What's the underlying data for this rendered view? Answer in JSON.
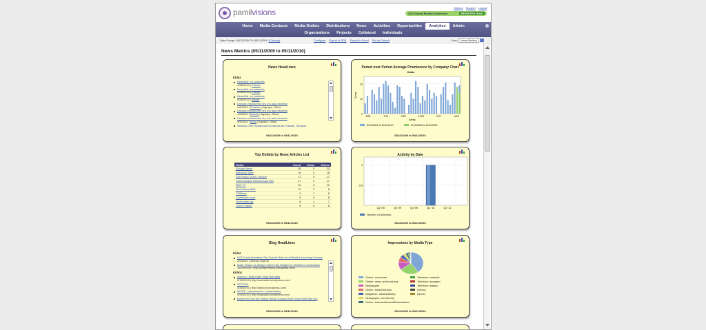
{
  "brand": {
    "prefix": "pamil",
    "suffix": "visions"
  },
  "top_links": [
    "Options",
    "Support",
    "Logout"
  ],
  "conference_banner": {
    "text": "2010 Social Media Conference",
    "button": "REGISTER NOW"
  },
  "nav": {
    "row1": [
      "Home",
      "Media Contacts",
      "Media Outlets",
      "Distributions",
      "News",
      "Activities",
      "Opportunities",
      "Analytics",
      "Admin"
    ],
    "active": "Analytics",
    "row2": [
      "Organizations",
      "Projects",
      "Collateral",
      "Individuals"
    ]
  },
  "subbar": {
    "date_range_label": "Date Range:",
    "date_from": "05/11/2009",
    "date_to_label": "To",
    "date_to": "05/11/2010",
    "change_link": "(Change)",
    "links": [
      "Configure",
      "Export to PDF",
      "Export to Excel",
      "Set as Default"
    ],
    "view_label": "View:",
    "view_value": "News Metrics"
  },
  "page_title": "News Metrics (05/11/2009 to 05/11/2010)",
  "period_label": "05/11/2009 to 05/11/2010",
  "colors": {
    "nav": "#5a5d8f",
    "panel": "#fffccb",
    "series_blue": "#7ea6d6",
    "series_green": "#8fcd6a",
    "bar_column": "#4a78b4"
  },
  "news_headlines": {
    "title": "News HeadLines",
    "group": "Kidoz",
    "items": [
      {
        "link": "News/Biz, no pracetes",
        "date": "4/28/2010",
        "source": "Estoria",
        "author": ""
      },
      {
        "link": "News/Biz, no pracetes",
        "date": "4/28/2010",
        "source": "Estoria",
        "author": ""
      },
      {
        "link": "News/Biz, no pracetes",
        "date": "4/28/2010",
        "source": "Morah",
        "author": ""
      },
      {
        "link": "Lanuna emcesertno tiru mo aula esmeria",
        "date": "4/6/2010",
        "source": "Federico",
        "author": "Aguayo, Olivia"
      },
      {
        "link": "Lanuna emcesertno tiru mo aula esmeria",
        "date": "4/5/2010",
        "source": "Estoria",
        "author": "Aguayo, Olivia"
      },
      {
        "link": "Lanuna emcesertno tiru mo aula esmeria",
        "date": "4/5/2010",
        "source": "Kevo",
        "author": "Aguayo, Olivia"
      },
      {
        "link": "Seguido Tien Hanarquita Omarmas de entrade, Tiburaso",
        "date": "",
        "source": "",
        "author": ""
      }
    ]
  },
  "pop_chart": {
    "title": "Period over Period Average Prominence by Company Chart",
    "subtitle": "Kidoz",
    "ylabel": "Score",
    "xlabel": "Week",
    "x_ticks": [
      "5/30",
      "7/12",
      "9/20",
      "11/29",
      "2/07",
      "4/18"
    ],
    "y_ticks": [
      "0",
      "10",
      "20"
    ],
    "ylim": [
      0,
      25
    ],
    "series": [
      {
        "name": "5/11/2009 to 5/11/2010",
        "color": "#7ea6d6",
        "values": [
          7,
          12,
          0,
          16,
          13,
          9,
          18,
          10,
          20,
          22,
          19,
          14,
          8,
          4,
          19,
          18,
          12,
          10,
          0,
          6,
          14,
          10,
          22,
          18,
          7,
          12,
          9,
          20,
          16,
          10,
          14,
          12,
          0,
          13,
          18,
          21,
          9,
          6,
          13,
          21,
          12,
          19
        ]
      },
      {
        "name": "5/11/2008 to 5/11/2009",
        "color": "#8fcd6a",
        "values": [
          0,
          0,
          0,
          0,
          0,
          0,
          0,
          0,
          0,
          0,
          0,
          0,
          0,
          0,
          0,
          0,
          0,
          0,
          0,
          0,
          0,
          0,
          0,
          0,
          0,
          0,
          0,
          0,
          0,
          0,
          0,
          0,
          0,
          0,
          0,
          0,
          0,
          0,
          0,
          0,
          18,
          14
        ]
      }
    ]
  },
  "top_outlets": {
    "title": "Top Outlets by News Articles List",
    "columns": [
      "Outlet",
      "Count",
      "Kidoz",
      "Kidroz"
    ],
    "rows": [
      [
        "Google News",
        "28",
        "0",
        "23"
      ],
      [
        "Business Wire",
        "16",
        "0",
        "16"
      ],
      [
        "San Diego Union-Tribune",
        "17",
        "0",
        "17"
      ],
      [
        "Communique Electronique Mid",
        "17",
        "0",
        "17"
      ],
      [
        "NBC TV",
        "10",
        "0",
        "10"
      ],
      [
        "Tech News ABC",
        "10",
        "3",
        "8"
      ],
      [
        "TMNews",
        "9",
        "1",
        "8"
      ],
      [
        "Lovebloom.com",
        "8",
        "0",
        "8"
      ],
      [
        "Technorati.org",
        "8",
        "1",
        "7"
      ],
      [
        "Green Planet",
        "8",
        "0",
        "8"
      ]
    ]
  },
  "activity_chart": {
    "title": "Activity by Date",
    "categories": [
      "Q2 '09",
      "Q3 '09",
      "Q4 '09",
      "Q1 '10",
      "Q2 '10"
    ],
    "values": [
      0,
      0,
      0,
      1,
      0
    ],
    "y_ticks": [
      "0.5",
      "1"
    ],
    "ylim": [
      0,
      1.2
    ],
    "legend": "Number of Activities"
  },
  "blog_headlines": {
    "title": "Blog HeadLines",
    "groups": [
      {
        "name": "Kidoz",
        "items": [
          {
            "link": "HOLD and Advertise City Tola de Bota en el Braile's Learning Journey",
            "meta": "2/5/2010 | Gemas Galeria"
          },
          {
            "link": "Make Shane an Aleign Coffee Day Delight for Children's Graduation",
            "meta": "12/29/2009 | http://prophetbelly.wordpress.com/"
          }
        ]
      },
      {
        "name": "Kidroz",
        "items": [
          {
            "link": "Aducuo / Ailial Dalfs Vista Bonnaris",
            "meta": "5/13/2010 | http://someded.wordpress.com/"
          },
          {
            "link": "SOTERA",
            "meta": "4/28/2010 | http://latvilcvwordpress.com/"
          },
          {
            "link": "NOTIZ - oooooooooo - oooooooooo",
            "meta": "4/28/2010 | http://lcassidor.wordpress.com/"
          },
          {
            "link": "Bonne en Eon Ete Hatow HitOut Goaran Wolf Deals With Bas Dio",
            "meta": ""
          }
        ]
      }
    ]
  },
  "impressions_chart": {
    "title": "Impressions by Media Type",
    "type": "pie",
    "slices": [
      {
        "label": "Online, consumer",
        "value": 40,
        "color": "#7fa6d6"
      },
      {
        "label": "Online, news and business",
        "value": 25,
        "color": "#95d36c"
      },
      {
        "label": "Newspaper",
        "value": 12,
        "color": "#c75bc2"
      },
      {
        "label": "Online, trade/industry",
        "value": 7,
        "color": "#e06a6a"
      },
      {
        "label": "Magazine, trade/industry",
        "value": 5,
        "color": "#4a62b0"
      },
      {
        "label": "Newspaper, community",
        "value": 4,
        "color": "#d6d66a"
      },
      {
        "label": "Online, technical/scientific/academic",
        "value": 3,
        "color": "#3e6f7e"
      },
      {
        "label": "Television network",
        "value": 2,
        "color": "#3f9a3f"
      },
      {
        "label": "Television program",
        "value": 1,
        "color": "#b03030"
      },
      {
        "label": "Television station",
        "value": 0.6,
        "color": "#3a3a9a"
      },
      {
        "label": "(Other)",
        "value": 0.3,
        "color": "#444"
      },
      {
        "label": "(None)",
        "value": 0.1,
        "color": "#a08a2a"
      }
    ]
  }
}
